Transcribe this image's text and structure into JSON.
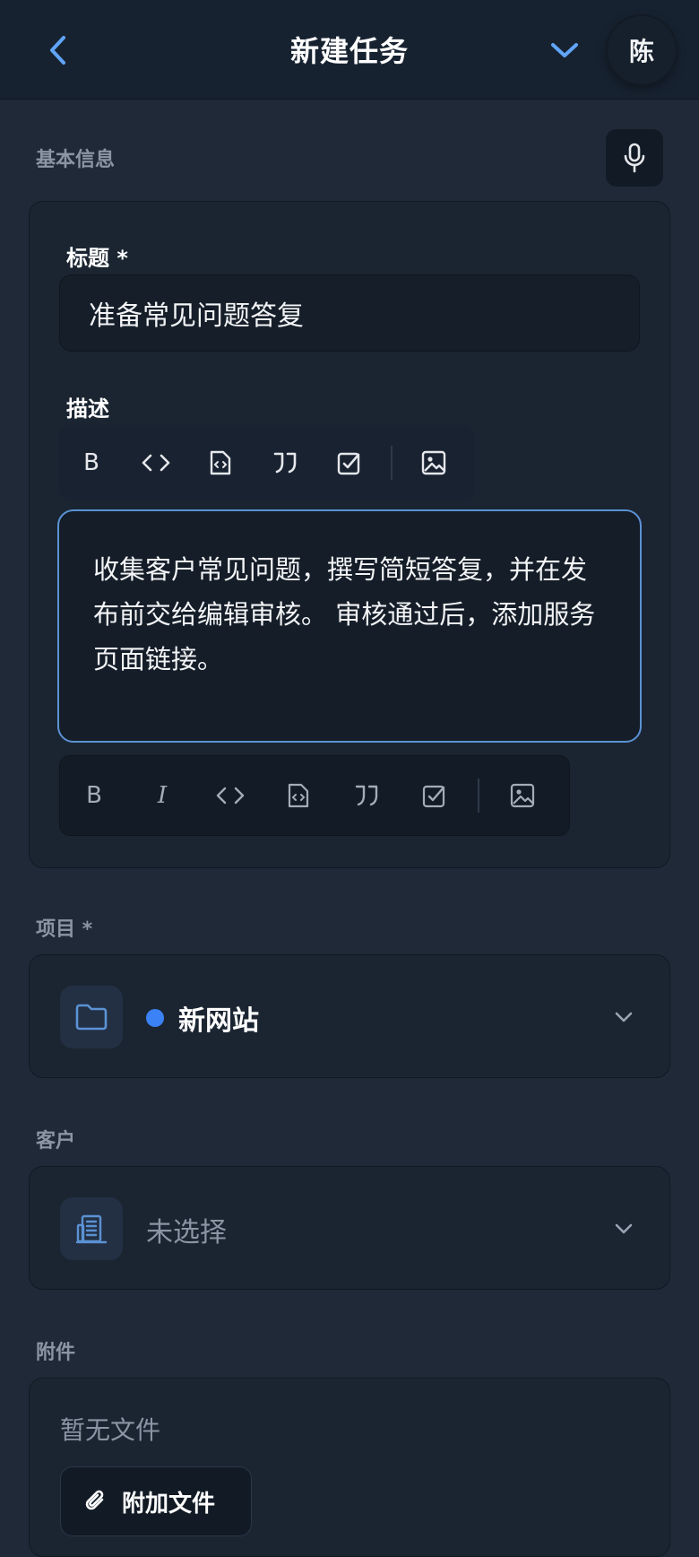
{
  "header": {
    "title": "新建任务",
    "avatar_initial": "陈"
  },
  "sections": {
    "basic_info": "基本信息",
    "project": "项目 *",
    "client": "客户",
    "attachments": "附件"
  },
  "form": {
    "title_label": "标题 *",
    "title_value": "准备常见问题答复",
    "description_label": "描述",
    "description_value": "收集客户常见问题，撰写简短答复，并在发布前交给编辑审核。 审核通过后，添加服务页面链接。"
  },
  "toolbar_top": {
    "bold": "B"
  },
  "toolbar_bottom": {
    "bold": "B",
    "italic": "I"
  },
  "project": {
    "selected": "新网站",
    "dot_color": "#3b82f6"
  },
  "client": {
    "placeholder": "未选择"
  },
  "attachments": {
    "empty_text": "暂无文件",
    "attach_button": "附加文件"
  },
  "colors": {
    "accent": "#5b92d4",
    "background": "#1f2937"
  }
}
